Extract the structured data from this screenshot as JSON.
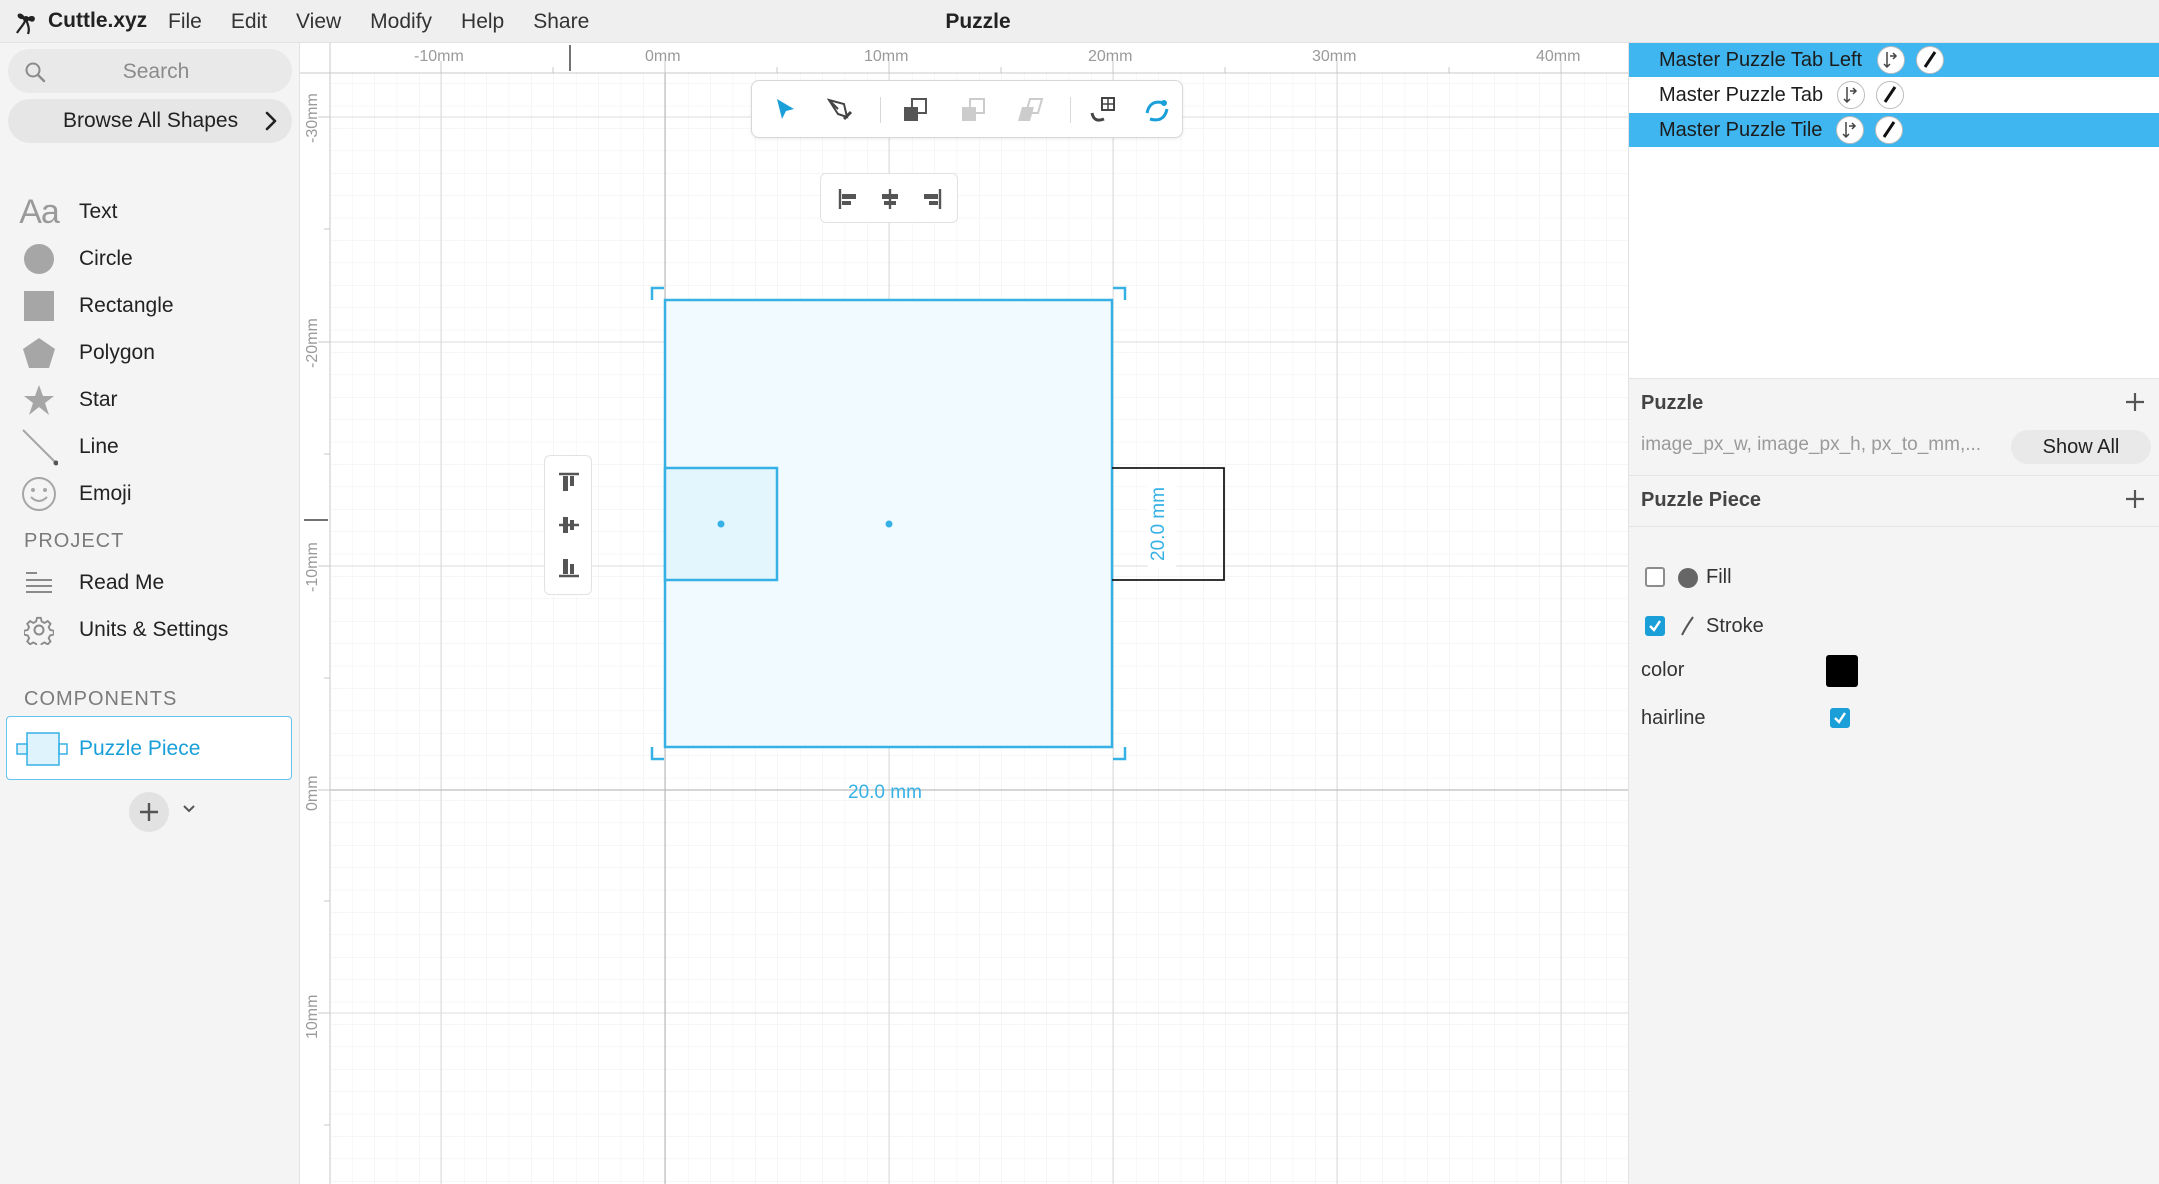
{
  "app": {
    "brand": "Cuttle.xyz",
    "menu": [
      "File",
      "Edit",
      "View",
      "Modify",
      "Help",
      "Share"
    ],
    "document_title": "Puzzle"
  },
  "sidebar": {
    "search_placeholder": "Search",
    "browse_label": "Browse All Shapes",
    "shapes": [
      {
        "label": "Text",
        "icon": "text-icon"
      },
      {
        "label": "Circle",
        "icon": "circle-icon"
      },
      {
        "label": "Rectangle",
        "icon": "rectangle-icon"
      },
      {
        "label": "Polygon",
        "icon": "polygon-icon"
      },
      {
        "label": "Star",
        "icon": "star-icon"
      },
      {
        "label": "Line",
        "icon": "line-icon"
      },
      {
        "label": "Emoji",
        "icon": "emoji-icon"
      }
    ],
    "text_icon_glyph": "Aa",
    "project_heading": "PROJECT",
    "project_items": [
      {
        "label": "Read Me",
        "icon": "readme-icon"
      },
      {
        "label": "Units & Settings",
        "icon": "gear-icon"
      }
    ],
    "components_heading": "COMPONENTS",
    "components": [
      {
        "label": "Puzzle Piece",
        "selected": true
      }
    ]
  },
  "canvas": {
    "ruler_x_labels": [
      "-10mm",
      "0mm",
      "10mm",
      "20mm",
      "30mm",
      "40mm"
    ],
    "ruler_y_labels": [
      "-30mm",
      "-20mm",
      "-10mm",
      "0mm",
      "10mm"
    ],
    "width_label": "20.0 mm",
    "height_label": "20.0 mm",
    "accent_color": "#36b1e6"
  },
  "right_panel": {
    "layers": [
      {
        "name": "Master Puzzle Tab Left",
        "selected": true
      },
      {
        "name": "Master Puzzle Tab",
        "selected": false
      },
      {
        "name": "Master Puzzle Tile",
        "selected": true
      }
    ],
    "puzzle_heading": "Puzzle",
    "puzzle_params": "image_px_w, image_px_h, px_to_mm,...",
    "show_all_label": "Show All",
    "piece_heading": "Puzzle Piece",
    "fill_label": "Fill",
    "fill_checked": false,
    "stroke_label": "Stroke",
    "stroke_checked": true,
    "color_label": "color",
    "color_value": "#000000",
    "hairline_label": "hairline",
    "hairline_checked": true
  }
}
